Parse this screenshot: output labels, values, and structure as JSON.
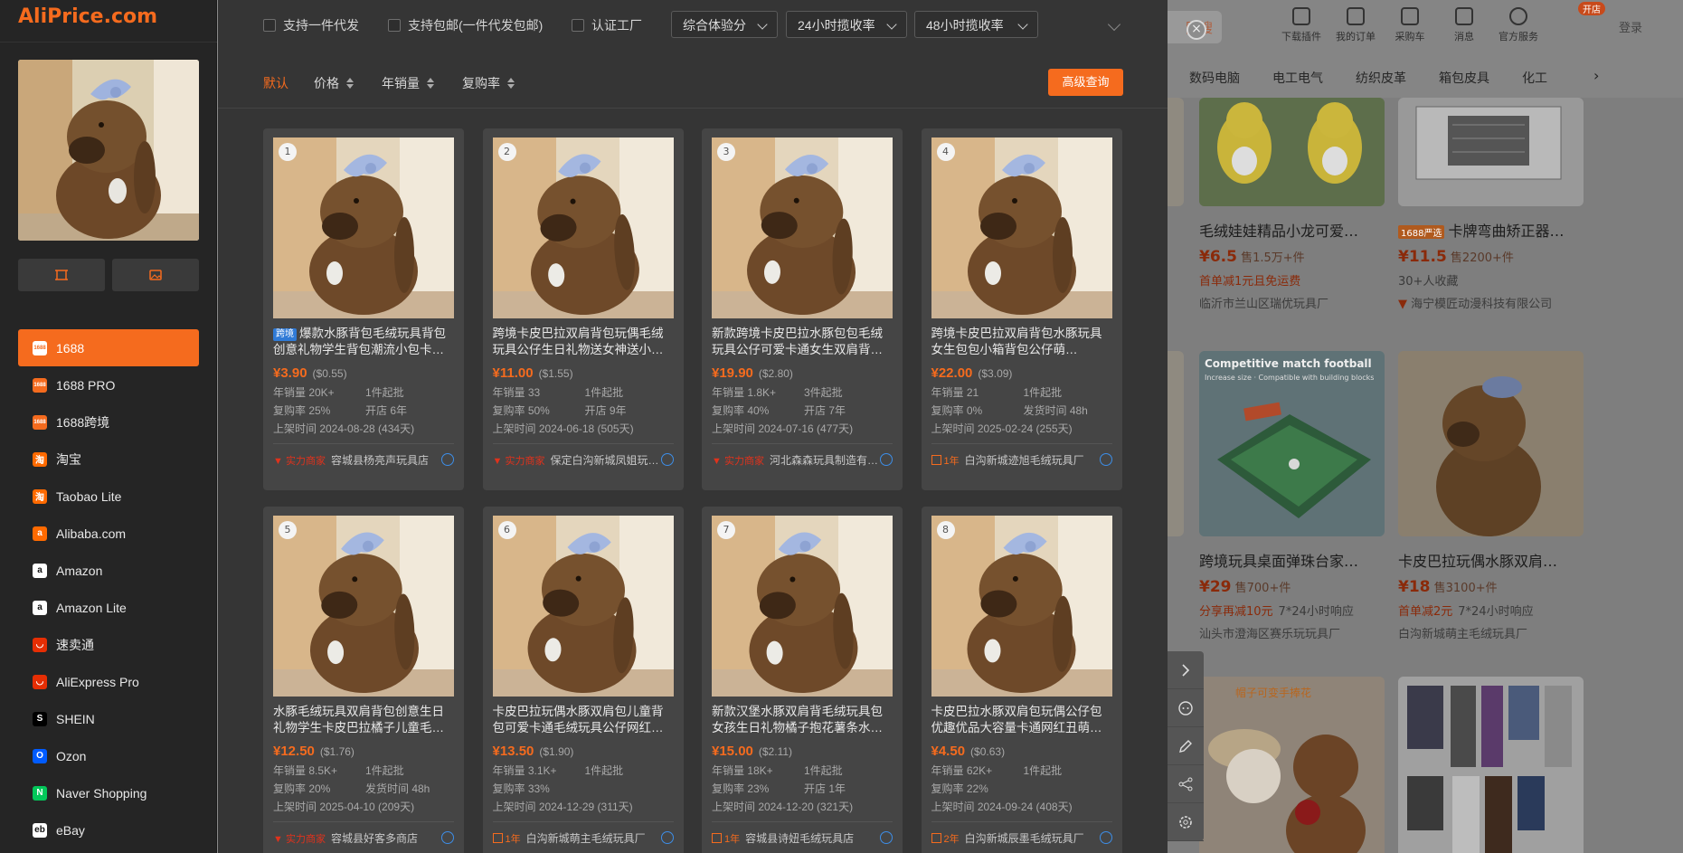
{
  "bg_page": {
    "search_label": "图搜",
    "header_icons": [
      {
        "label": "下载插件",
        "icon": "puzzle-icon"
      },
      {
        "label": "我的订单",
        "icon": "order-icon"
      },
      {
        "label": "采购车",
        "icon": "cart-icon"
      },
      {
        "label": "消息",
        "icon": "message-icon"
      },
      {
        "label": "官方服务",
        "icon": "service-icon"
      }
    ],
    "badge": "开店",
    "login": "登录",
    "categories": [
      "数码电脑",
      "电工电气",
      "纺织皮革",
      "箱包皮具",
      "化工"
    ],
    "products": [
      {
        "title": "毛绒娃娃精品小龙可爱…",
        "price": "¥6.5",
        "sold": "售1.5万+件",
        "promo": "首单减1元且免运费",
        "promo_extra": "",
        "shop": "临沂市兰山区瑞优玩具厂",
        "tag": ""
      },
      {
        "title": "卡牌弯曲矫正器…",
        "price": "¥11.5",
        "sold": "售2200+件",
        "promo": "",
        "promo_extra": "30+人收藏",
        "shop": "海宁模匠动漫科技有限公司",
        "tag": "1688严选"
      },
      {
        "title": "跨境玩具桌面弹珠台家…",
        "price": "¥29",
        "sold": "售700+件",
        "promo": "分享再减10元",
        "promo_extra": "7*24小时响应",
        "shop": "汕头市澄海区赛乐玩玩具厂",
        "tag": ""
      },
      {
        "title": "卡皮巴拉玩偶水豚双肩…",
        "price": "¥18",
        "sold": "售3100+件",
        "promo": "首单减2元",
        "promo_extra": "7*24小时响应",
        "shop": "白沟新城萌主毛绒玩具厂",
        "tag": ""
      }
    ],
    "football_box": {
      "title": "Competitive match football",
      "sub": "Increase size · Compatible with building blocks"
    },
    "teddy_caption": "帽子可变手捧花"
  },
  "left": {
    "logo": "AliPrice.com",
    "platforms": [
      {
        "label": "1688",
        "icon": "1688-icon",
        "color": "#f56b1e",
        "glyph": "1688"
      },
      {
        "label": "1688 PRO",
        "icon": "1688-pro-icon",
        "color": "#f56b1e",
        "glyph": "1688"
      },
      {
        "label": "1688跨境",
        "icon": "1688-crossborder-icon",
        "color": "#f56b1e",
        "glyph": "1688"
      },
      {
        "label": "淘宝",
        "icon": "taobao-icon",
        "color": "#ff6a00",
        "glyph": "淘"
      },
      {
        "label": "Taobao Lite",
        "icon": "taobao-lite-icon",
        "color": "#ff6a00",
        "glyph": "淘"
      },
      {
        "label": "Alibaba.com",
        "icon": "alibaba-icon",
        "color": "#ff6a00",
        "glyph": "a"
      },
      {
        "label": "Amazon",
        "icon": "amazon-icon",
        "color": "#ffffff",
        "glyph": "a"
      },
      {
        "label": "Amazon Lite",
        "icon": "amazon-lite-icon",
        "color": "#ffffff",
        "glyph": "a"
      },
      {
        "label": "速卖通",
        "icon": "aliexpress-icon",
        "color": "#e62e04",
        "glyph": "◡"
      },
      {
        "label": "AliExpress Pro",
        "icon": "aliexpress-pro-icon",
        "color": "#e62e04",
        "glyph": "◡"
      },
      {
        "label": "SHEIN",
        "icon": "shein-icon",
        "color": "#000000",
        "glyph": "S"
      },
      {
        "label": "Ozon",
        "icon": "ozon-icon",
        "color": "#005bff",
        "glyph": "O"
      },
      {
        "label": "Naver Shopping",
        "icon": "naver-icon",
        "color": "#03c75a",
        "glyph": "N"
      },
      {
        "label": "eBay",
        "icon": "ebay-icon",
        "color": "#ffffff",
        "glyph": "eb"
      }
    ]
  },
  "filters": {
    "checkboxes": [
      "支持一件代发",
      "支持包邮(一件代发包邮)",
      "认证工厂"
    ],
    "dropdowns": [
      "综合体验分",
      "24小时揽收率",
      "48小时揽收率"
    ]
  },
  "sorts": {
    "default": "默认",
    "price": "价格",
    "annual_sales": "年销量",
    "repurchase": "复购率"
  },
  "advanced_button": "高级查询",
  "products": [
    {
      "num": "1",
      "tag": "跨境",
      "title": "爆款水豚背包毛绒玩具背包创意礼物学生背包潮流小包卡…",
      "price": "¥3.90",
      "usd": "($0.55)",
      "m1": "年销量 20K+",
      "m2": "1件起批",
      "m3": "复购率 25%",
      "m4": "开店 6年",
      "listed": "上架时间 2024-08-28 (434天)",
      "badge": "实力商家",
      "badge_type": "power",
      "shop": "容城县杨亮声玩具店"
    },
    {
      "num": "2",
      "tag": "",
      "title": "跨境卡皮巴拉双肩背包玩偶毛绒玩具公仔生日礼物送女神送小…",
      "price": "¥11.00",
      "usd": "($1.55)",
      "m1": "年销量 33",
      "m2": "1件起批",
      "m3": "复购率 50%",
      "m4": "开店 9年",
      "listed": "上架时间 2024-06-18 (505天)",
      "badge": "实力商家",
      "badge_type": "power",
      "shop": "保定白沟新城凤姐玩…"
    },
    {
      "num": "3",
      "tag": "",
      "title": "新款跨境卡皮巴拉水豚包包毛绒玩具公仔可爱卡通女生双肩背…",
      "price": "¥19.90",
      "usd": "($2.80)",
      "m1": "年销量 1.8K+",
      "m2": "3件起批",
      "m3": "复购率 40%",
      "m4": "开店 7年",
      "listed": "上架时间 2024-07-16 (477天)",
      "badge": "实力商家",
      "badge_type": "power",
      "shop": "河北森森玩具制造有…"
    },
    {
      "num": "4",
      "tag": "",
      "title": "跨境卡皮巴拉双肩背包水豚玩具女生包包小箱背包公仔萌…",
      "price": "¥22.00",
      "usd": "($3.09)",
      "m1": "年销量 21",
      "m2": "1件起批",
      "m3": "复购率 0%",
      "m4": "发货时间 48h",
      "listed": "上架时间 2025-02-24 (255天)",
      "badge": "1年",
      "badge_type": "year",
      "shop": "白沟新城迹旭毛绒玩具厂"
    },
    {
      "num": "5",
      "tag": "",
      "title": "水豚毛绒玩具双肩背包创意生日礼物学生卡皮巴拉橘子儿童毛…",
      "price": "¥12.50",
      "usd": "($1.76)",
      "m1": "年销量 8.5K+",
      "m2": "1件起批",
      "m3": "复购率 20%",
      "m4": "发货时间 48h",
      "listed": "上架时间 2025-04-10 (209天)",
      "badge": "实力商家",
      "badge_type": "power",
      "shop": "容城县好客多商店"
    },
    {
      "num": "6",
      "tag": "",
      "title": "卡皮巴拉玩偶水豚双肩包儿童背包可爱卡通毛绒玩具公仔网红…",
      "price": "¥13.50",
      "usd": "($1.90)",
      "m1": "年销量 3.1K+",
      "m2": "1件起批",
      "m3": "复购率 33%",
      "m4": "",
      "listed": "上架时间 2024-12-29 (311天)",
      "badge": "1年",
      "badge_type": "year",
      "shop": "白沟新城萌主毛绒玩具厂"
    },
    {
      "num": "7",
      "tag": "",
      "title": "新款汉堡水豚双肩背毛绒玩具包女孩生日礼物橘子抱花薯条水…",
      "price": "¥15.00",
      "usd": "($2.11)",
      "m1": "年销量 18K+",
      "m2": "1件起批",
      "m3": "复购率 23%",
      "m4": "开店 1年",
      "listed": "上架时间 2024-12-20 (321天)",
      "badge": "1年",
      "badge_type": "year",
      "shop": "容城县诗妞毛绒玩具店"
    },
    {
      "num": "8",
      "tag": "",
      "title": "卡皮巴拉水豚双肩包玩偶公仔包优趣优品大容量卡通网红丑萌…",
      "price": "¥4.50",
      "usd": "($0.63)",
      "m1": "年销量 62K+",
      "m2": "1件起批",
      "m3": "复购率 22%",
      "m4": "",
      "listed": "上架时间 2024-09-24 (408天)",
      "badge": "2年",
      "badge_type": "year",
      "shop": "白沟新城辰墨毛绒玩具厂"
    }
  ],
  "colors": {
    "accent": "#f56b1e",
    "panel": "#353535",
    "card": "#454545",
    "power_badge": "#e0321c"
  }
}
